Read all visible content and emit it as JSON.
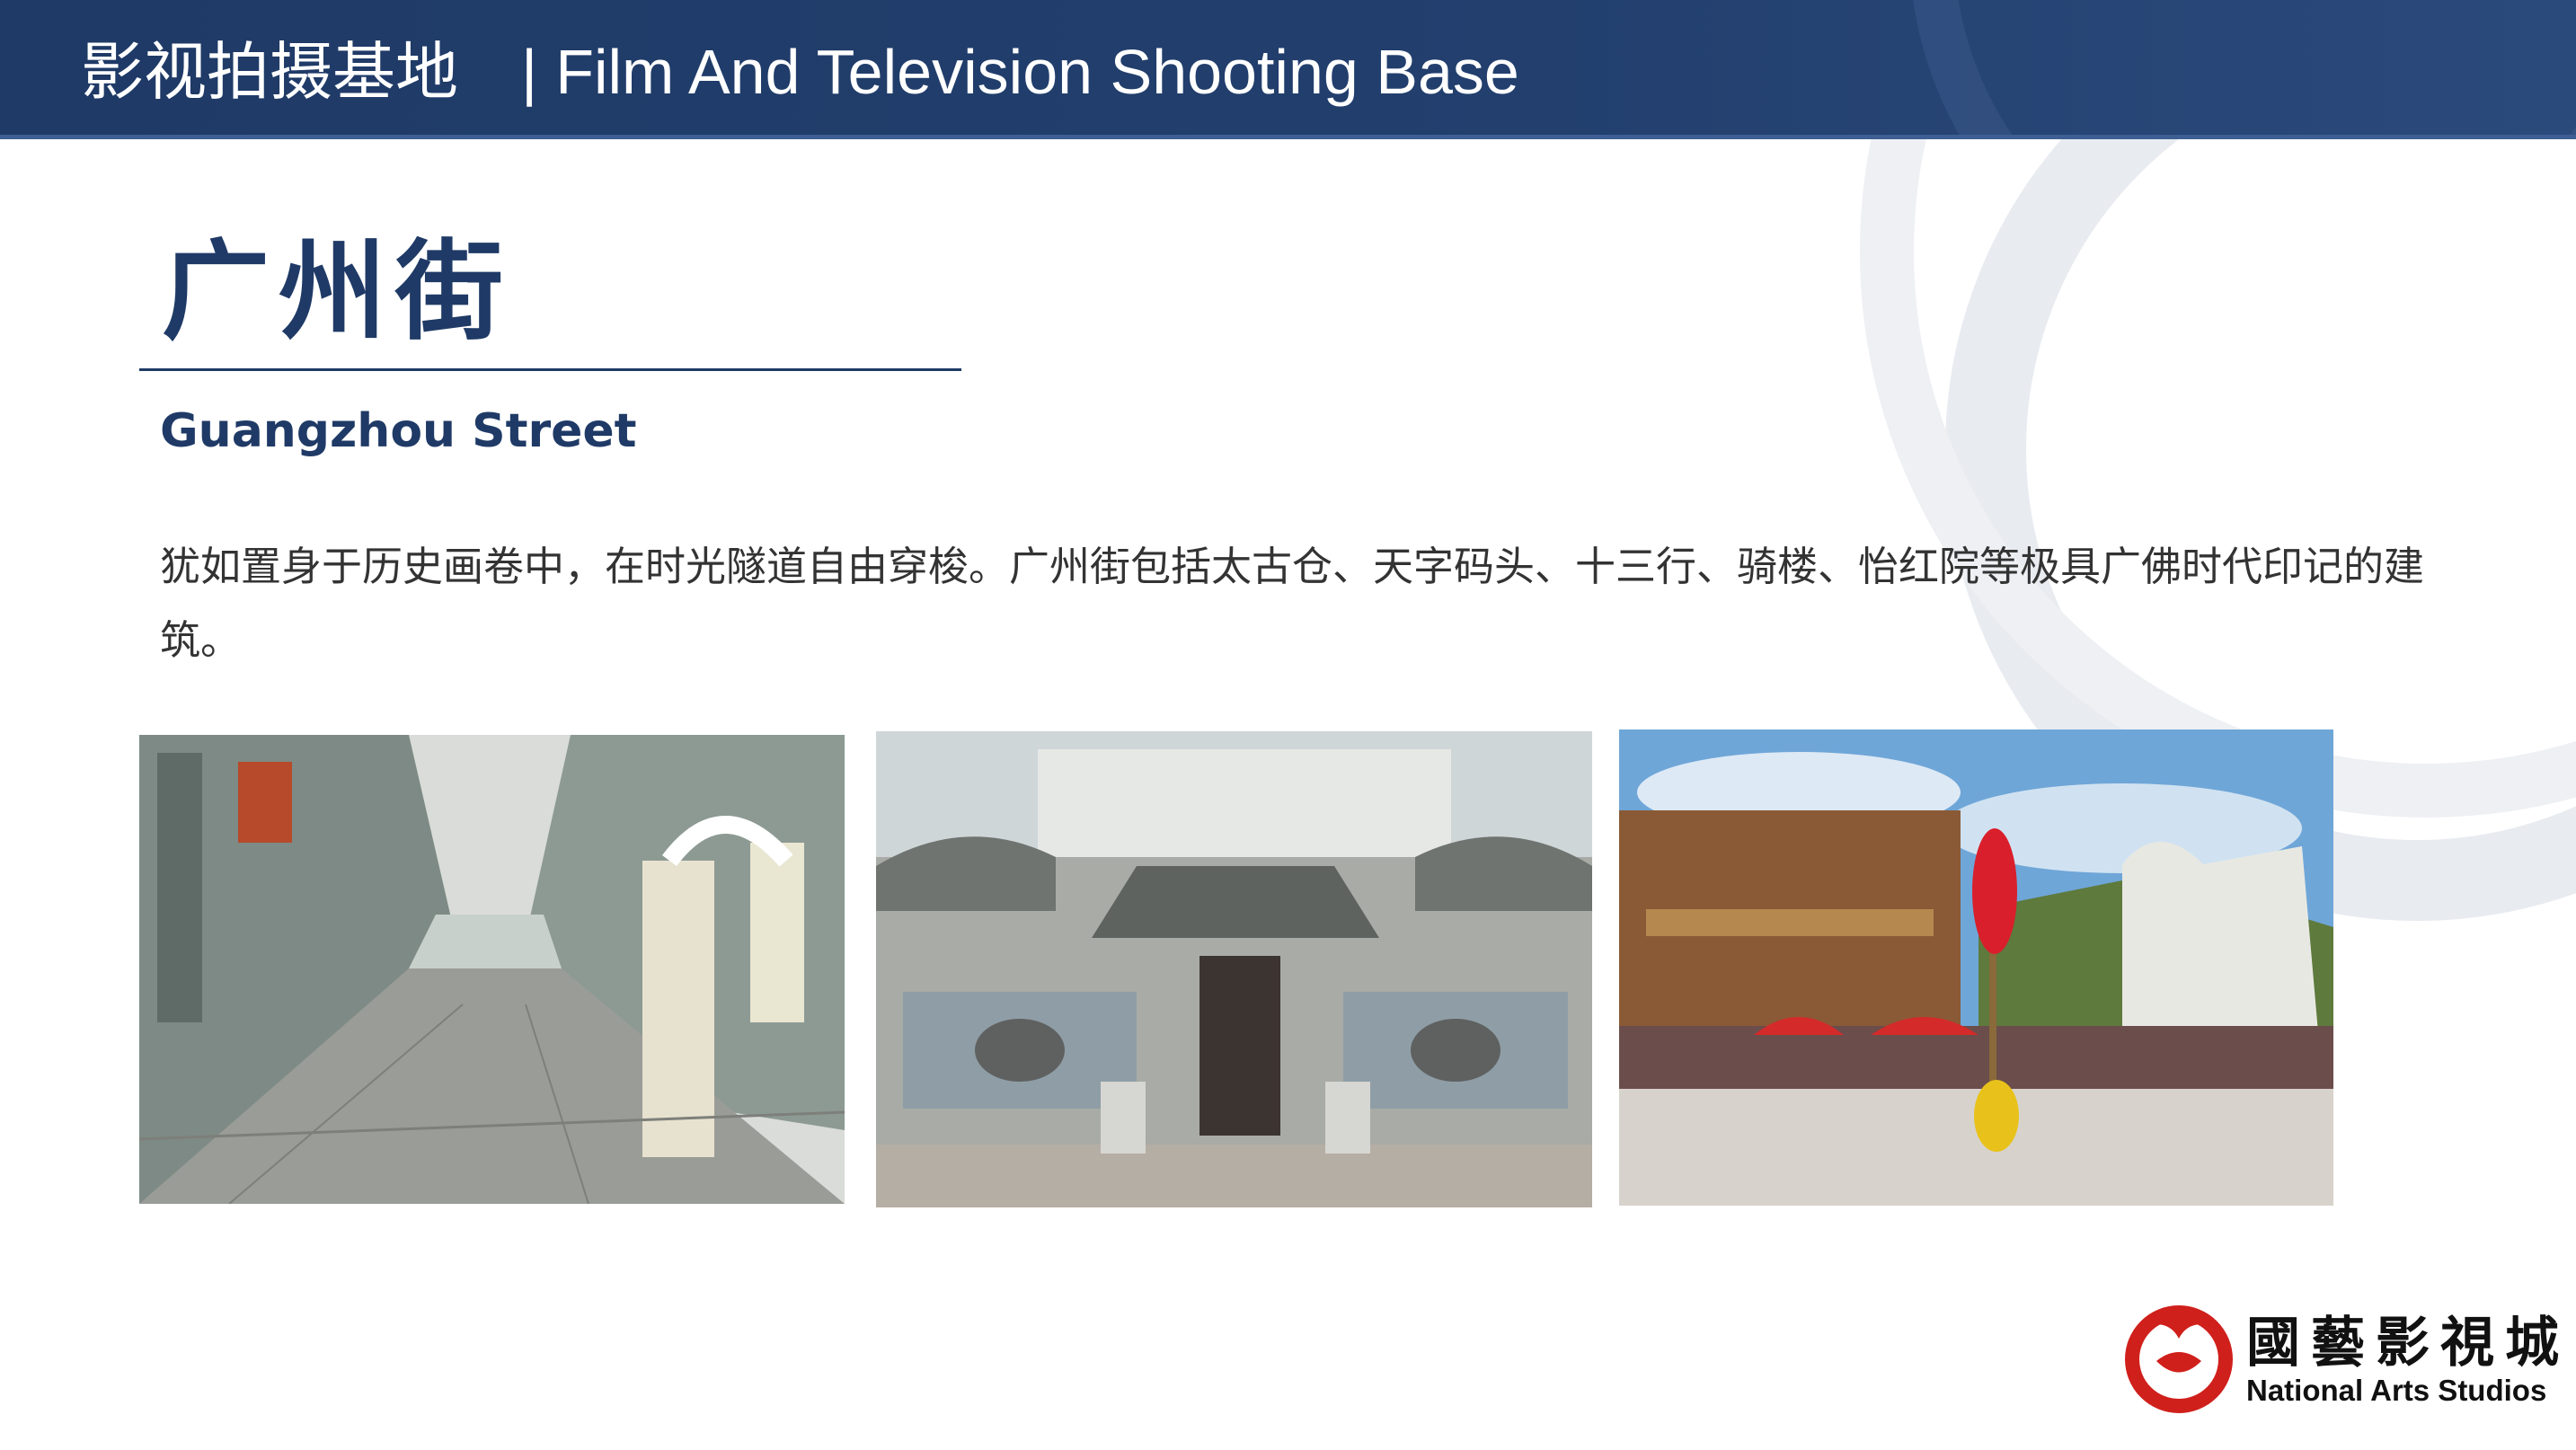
{
  "header": {
    "title_zh": "影视拍摄基地",
    "separator": "|",
    "title_en": "Film And Television Shooting Base"
  },
  "section": {
    "title_zh": "广州街",
    "title_en": "Guangzhou Street",
    "description": "犹如置身于历史画卷中，在时光隧道自由穿梭。广州街包括太古仓、天字码头、十三行、骑楼、怡红院等极具广佛时代印记的建筑。"
  },
  "photos": [
    {
      "name": "street-view-photo"
    },
    {
      "name": "traditional-building-photo"
    },
    {
      "name": "lion-dance-photo"
    }
  ],
  "logo": {
    "name_zh": "國藝影視城",
    "name_en": "National Arts Studios"
  },
  "colors": {
    "primary": "#1f3a66",
    "ring": "#e9ecf1",
    "logo_red": "#d0201c"
  }
}
